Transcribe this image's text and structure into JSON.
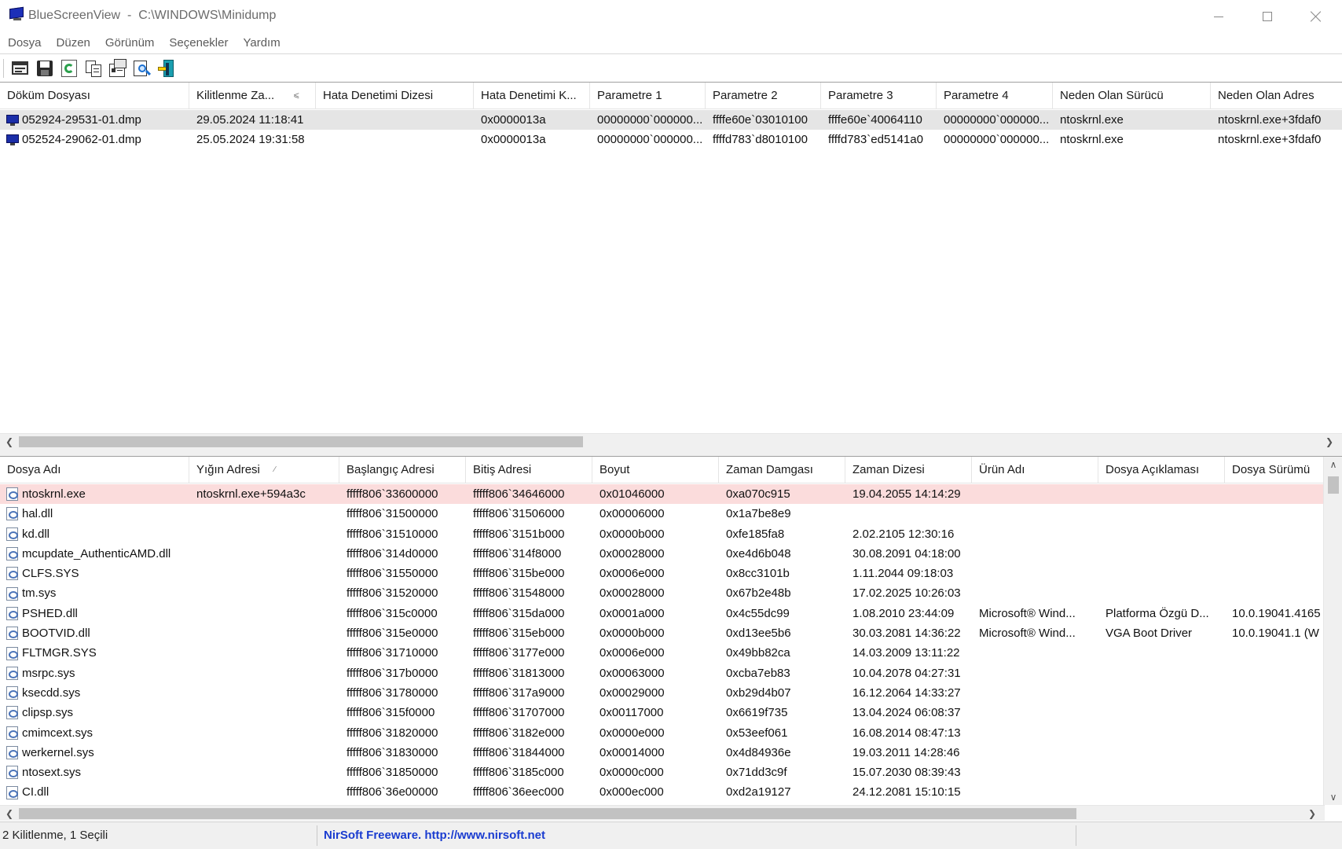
{
  "window": {
    "app_name": "BlueScreenView",
    "title_sep": "  -  ",
    "path": "C:\\WINDOWS\\Minidump",
    "icon": "bluescreen-monitor-icon"
  },
  "menu": [
    "Dosya",
    "Düzen",
    "Görünüm",
    "Seçenekler",
    "Yardım"
  ],
  "toolbar": {
    "buttons": [
      "properties-icon",
      "save-icon",
      "refresh-icon",
      "copy-icon",
      "html-report-icon",
      "find-icon",
      "exit-icon"
    ]
  },
  "dumps": {
    "columns": [
      "Döküm Dosyası",
      "Kilitlenme Za...",
      "Hata Denetimi Dizesi",
      "Hata Denetimi K...",
      "Parametre 1",
      "Parametre 2",
      "Parametre 3",
      "Parametre 4",
      "Neden Olan Sürücü",
      "Neden Olan Adres"
    ],
    "sort_indicator": "⩽",
    "rows": [
      [
        "052924-29531-01.dmp",
        "29.05.2024 11:18:41",
        "",
        "0x0000013a",
        "00000000`000000...",
        "ffffe60e`03010100",
        "ffffe60e`40064110",
        "00000000`000000...",
        "ntoskrnl.exe",
        "ntoskrnl.exe+3fdaf0"
      ],
      [
        "052524-29062-01.dmp",
        "25.05.2024 19:31:58",
        "",
        "0x0000013a",
        "00000000`000000...",
        "ffffd783`d8010100",
        "ffffd783`ed5141a0",
        "00000000`000000...",
        "ntoskrnl.exe",
        "ntoskrnl.exe+3fdaf0"
      ]
    ],
    "selected_row": 0
  },
  "modules": {
    "columns": [
      "Dosya Adı",
      "Yığın Adresi",
      "Başlangıç Adresi",
      "Bitiş Adresi",
      "Boyut",
      "Zaman Damgası",
      "Zaman Dizesi",
      "Ürün Adı",
      "Dosya Açıklaması",
      "Dosya Sürümü"
    ],
    "sort_indicator": "∕",
    "rows": [
      [
        "ntoskrnl.exe",
        "ntoskrnl.exe+594a3c",
        "fffff806`33600000",
        "fffff806`34646000",
        "0x01046000",
        "0xa070c915",
        "19.04.2055 14:14:29",
        "",
        "",
        ""
      ],
      [
        "hal.dll",
        "",
        "fffff806`31500000",
        "fffff806`31506000",
        "0x00006000",
        "0x1a7be8e9",
        "",
        "",
        "",
        ""
      ],
      [
        "kd.dll",
        "",
        "fffff806`31510000",
        "fffff806`3151b000",
        "0x0000b000",
        "0xfe185fa8",
        "2.02.2105 12:30:16",
        "",
        "",
        ""
      ],
      [
        "mcupdate_AuthenticAMD.dll",
        "",
        "fffff806`314d0000",
        "fffff806`314f8000",
        "0x00028000",
        "0xe4d6b048",
        "30.08.2091 04:18:00",
        "",
        "",
        ""
      ],
      [
        "CLFS.SYS",
        "",
        "fffff806`31550000",
        "fffff806`315be000",
        "0x0006e000",
        "0x8cc3101b",
        "1.11.2044 09:18:03",
        "",
        "",
        ""
      ],
      [
        "tm.sys",
        "",
        "fffff806`31520000",
        "fffff806`31548000",
        "0x00028000",
        "0x67b2e48b",
        "17.02.2025 10:26:03",
        "",
        "",
        ""
      ],
      [
        "PSHED.dll",
        "",
        "fffff806`315c0000",
        "fffff806`315da000",
        "0x0001a000",
        "0x4c55dc99",
        "1.08.2010 23:44:09",
        "Microsoft® Wind...",
        "Platforma Özgü D...",
        "10.0.19041.4165"
      ],
      [
        "BOOTVID.dll",
        "",
        "fffff806`315e0000",
        "fffff806`315eb000",
        "0x0000b000",
        "0xd13ee5b6",
        "30.03.2081 14:36:22",
        "Microsoft® Wind...",
        "VGA Boot Driver",
        "10.0.19041.1 (W"
      ],
      [
        "FLTMGR.SYS",
        "",
        "fffff806`31710000",
        "fffff806`3177e000",
        "0x0006e000",
        "0x49bb82ca",
        "14.03.2009 13:11:22",
        "",
        "",
        ""
      ],
      [
        "msrpc.sys",
        "",
        "fffff806`317b0000",
        "fffff806`31813000",
        "0x00063000",
        "0xcba7eb83",
        "10.04.2078 04:27:31",
        "",
        "",
        ""
      ],
      [
        "ksecdd.sys",
        "",
        "fffff806`31780000",
        "fffff806`317a9000",
        "0x00029000",
        "0xb29d4b07",
        "16.12.2064 14:33:27",
        "",
        "",
        ""
      ],
      [
        "clipsp.sys",
        "",
        "fffff806`315f0000",
        "fffff806`31707000",
        "0x00117000",
        "0x6619f735",
        "13.04.2024 06:08:37",
        "",
        "",
        ""
      ],
      [
        "cmimcext.sys",
        "",
        "fffff806`31820000",
        "fffff806`3182e000",
        "0x0000e000",
        "0x53eef061",
        "16.08.2014 08:47:13",
        "",
        "",
        ""
      ],
      [
        "werkernel.sys",
        "",
        "fffff806`31830000",
        "fffff806`31844000",
        "0x00014000",
        "0x4d84936e",
        "19.03.2011 14:28:46",
        "",
        "",
        ""
      ],
      [
        "ntosext.sys",
        "",
        "fffff806`31850000",
        "fffff806`3185c000",
        "0x0000c000",
        "0x71dd3c9f",
        "15.07.2030 08:39:43",
        "",
        "",
        ""
      ],
      [
        "CI.dll",
        "",
        "fffff806`36e00000",
        "fffff806`36eec000",
        "0x000ec000",
        "0xd2a19127",
        "24.12.2081 15:10:15",
        "",
        "",
        ""
      ]
    ],
    "highlighted_row": 0
  },
  "status": {
    "count_text": "2 Kilitlenme, 1 Seçili",
    "link_text": "NirSoft Freeware.  http://www.nirsoft.net"
  },
  "colors": {
    "selected_row": "#e5e5e5",
    "highlighted_row": "#fbdcdc",
    "link": "#1a3cd0"
  }
}
